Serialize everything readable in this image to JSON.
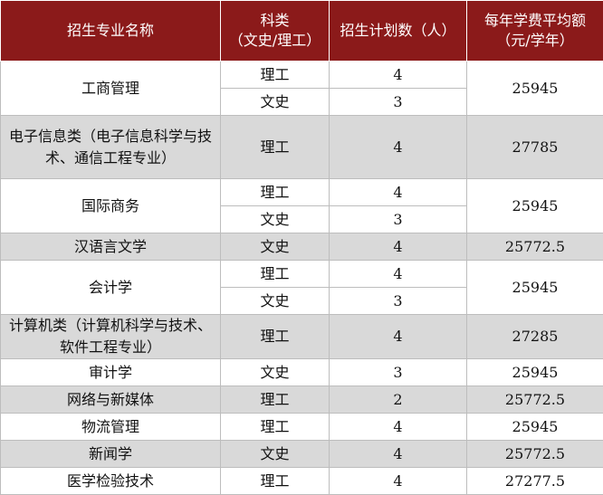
{
  "header": {
    "col1": "招生专业名称",
    "col2_line1": "科类",
    "col2_line2": "（文史/理工）",
    "col3": "招生计划数（人）",
    "col4_line1": "每年学费平均额",
    "col4_line2": "（元/学年）"
  },
  "rows": {
    "r1": {
      "major": "工商管理",
      "a_type": "理工",
      "a_count": "4",
      "b_type": "文史",
      "b_count": "3",
      "fee": "25945"
    },
    "r2": {
      "major": "电子信息类（电子信息科学与技术、通信工程专业）",
      "type": "理工",
      "count": "4",
      "fee": "27785"
    },
    "r3": {
      "major": "国际商务",
      "a_type": "理工",
      "a_count": "4",
      "b_type": "文史",
      "b_count": "3",
      "fee": "25945"
    },
    "r4": {
      "major": "汉语言文学",
      "type": "文史",
      "count": "4",
      "fee": "25772.5"
    },
    "r5": {
      "major": "会计学",
      "a_type": "理工",
      "a_count": "4",
      "b_type": "文史",
      "b_count": "3",
      "fee": "25945"
    },
    "r6": {
      "major": "计算机类（计算机科学与技术、软件工程专业）",
      "type": "理工",
      "count": "4",
      "fee": "27285"
    },
    "r7": {
      "major": "审计学",
      "type": "文史",
      "count": "3",
      "fee": "25945"
    },
    "r8": {
      "major": "网络与新媒体",
      "type": "理工",
      "count": "2",
      "fee": "25772.5"
    },
    "r9": {
      "major": "物流管理",
      "type": "理工",
      "count": "4",
      "fee": "25945"
    },
    "r10": {
      "major": "新闻学",
      "type": "文史",
      "count": "4",
      "fee": "25772.5"
    },
    "r11": {
      "major": "医学检验技术",
      "type": "理工",
      "count": "4",
      "fee": "27277.5"
    }
  }
}
